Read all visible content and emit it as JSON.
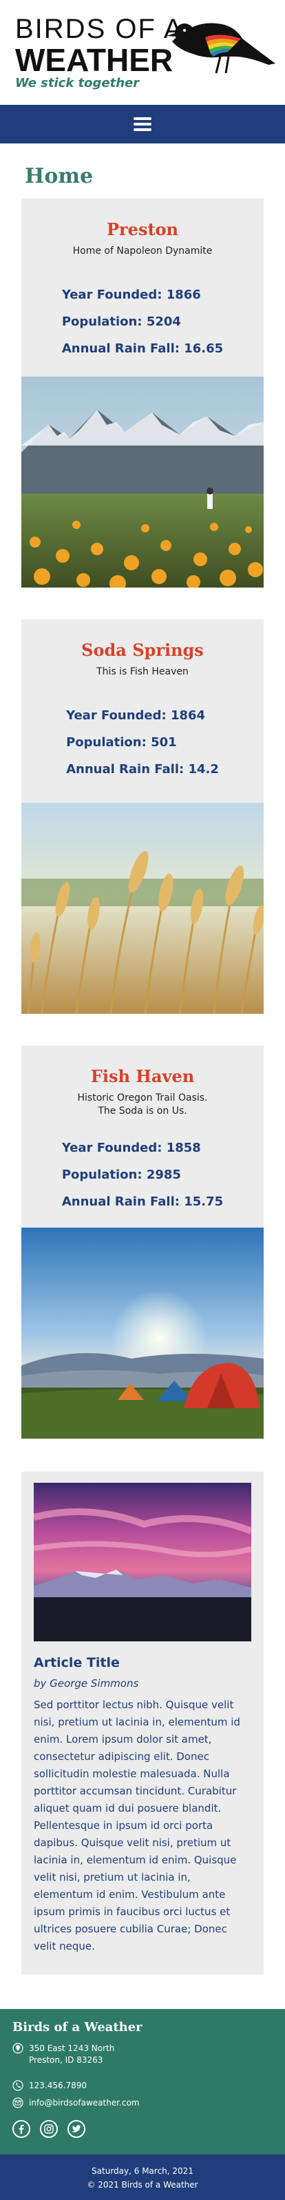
{
  "header": {
    "logo_line1": "BIRDS OF A",
    "logo_line2": "WEATHER",
    "tagline": "We stick together"
  },
  "page": {
    "title": "Home"
  },
  "towns": [
    {
      "name": "Preston",
      "subtitle": "Home of Napoleon Dynamite",
      "year": "Year Founded: 1866",
      "population": "Population: 5204",
      "rain": "Annual Rain Fall: 16.65"
    },
    {
      "name": "Soda Springs",
      "subtitle": "This is Fish Heaven",
      "year": "Year Founded: 1864",
      "population": "Population: 501",
      "rain": "Annual Rain Fall: 14.2"
    },
    {
      "name": "Fish Haven",
      "subtitle_line1": "Historic Oregon Trail Oasis.",
      "subtitle_line2": "The Soda is on Us.",
      "year": "Year Founded: 1858",
      "population": "Population: 2985",
      "rain": "Annual Rain Fall: 15.75"
    }
  ],
  "article": {
    "title": "Article Title",
    "author": "by George Simmons",
    "body": "Sed porttitor lectus nibh. Quisque velit nisi, pretium ut lacinia in, elementum id enim. Lorem ipsum dolor sit amet, consectetur adipiscing elit. Donec sollicitudin molestie malesuada. Nulla porttitor accumsan tincidunt. Curabitur aliquet quam id dui posuere blandit. Pellentesque in ipsum id orci porta dapibus. Quisque velit nisi, pretium ut lacinia in, elementum id enim. Quisque velit nisi, pretium ut lacinia in, elementum id enim. Vestibulum ante ipsum primis in faucibus orci luctus et ultrices posuere cubilia Curae; Donec velit neque."
  },
  "footer": {
    "title": "Birds of a Weather",
    "address_line1": "350 East 1243 North",
    "address_line2": "Preston, ID 83263",
    "phone": "123.456.7890",
    "email": "info@birdsofaweather.com",
    "social_icons": [
      "facebook-icon",
      "instagram-icon",
      "twitter-icon"
    ]
  },
  "bottom": {
    "date": "Saturday, 6 March, 2021",
    "copyright": "© 2021 Birds of a Weather"
  },
  "colors": {
    "navy": "#1f3e7b",
    "teal": "#2e7a66",
    "red_title": "#d8402a",
    "home_title": "#3c7a70",
    "card_bg": "#ececec"
  }
}
